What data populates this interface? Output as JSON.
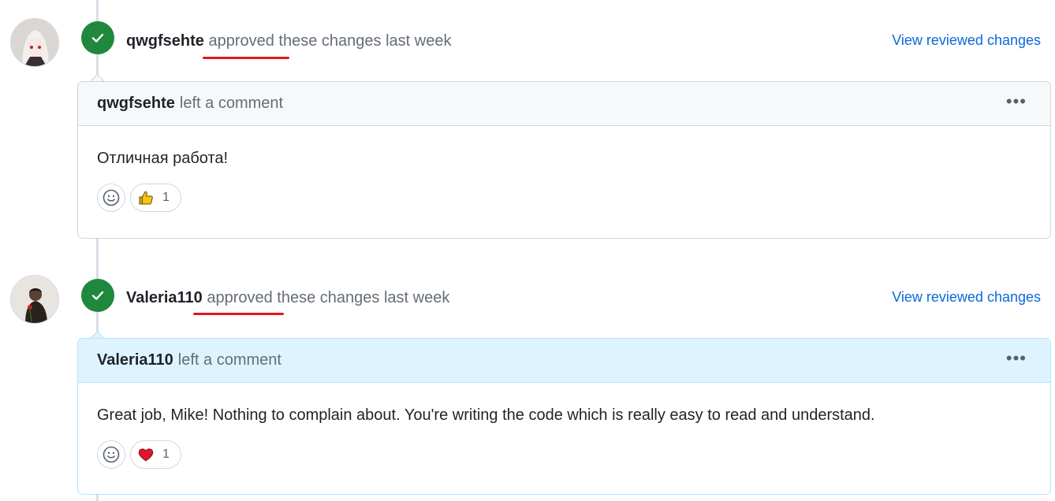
{
  "reviews": [
    {
      "reviewer": "qwgfsehte",
      "status_text": "approved these changes last week",
      "view_link": "View reviewed changes",
      "comment_author": "qwgfsehte",
      "comment_action": "left a comment",
      "comment_body": "Отличная работа!",
      "reaction": {
        "icon": "thumbs-up-icon",
        "count": "1"
      }
    },
    {
      "reviewer": "Valeria110",
      "status_text": "approved these changes last week",
      "view_link": "View reviewed changes",
      "comment_author": "Valeria110",
      "comment_action": "left a comment",
      "comment_body": "Great job, Mike! Nothing to complain about. You're writing the code which is really easy to read and understand.",
      "reaction": {
        "icon": "heart-icon",
        "count": "1"
      }
    }
  ],
  "colors": {
    "approved": "#1f883d",
    "link": "#0969da",
    "annotation": "#e3161d",
    "highlight_bg": "#ddf4ff"
  }
}
